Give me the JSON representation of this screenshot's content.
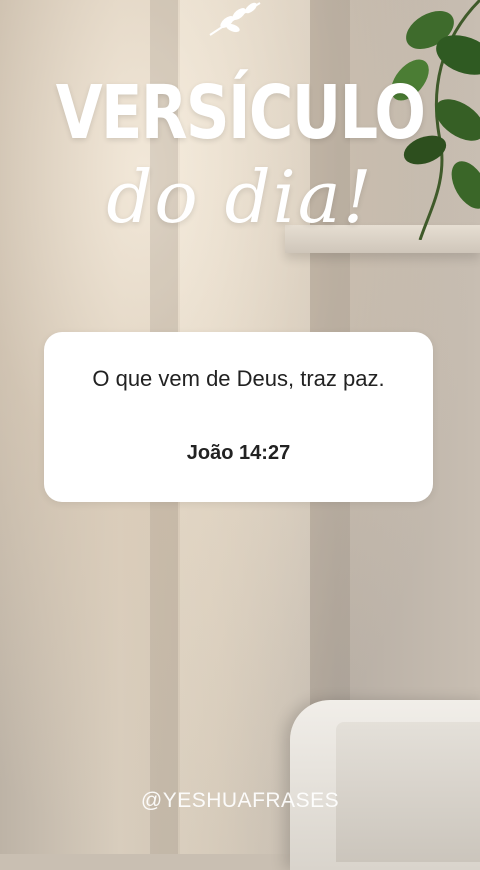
{
  "header": {
    "title": "VERSÍCULO",
    "subtitle": "do dia!"
  },
  "card": {
    "verse": "O que vem de Deus, traz paz.",
    "reference": "João 14:27"
  },
  "footer": {
    "handle": "@YESHUAFRASES"
  },
  "icons": {
    "sprig": "leaf-sprig-icon",
    "plant": "plant-icon"
  }
}
